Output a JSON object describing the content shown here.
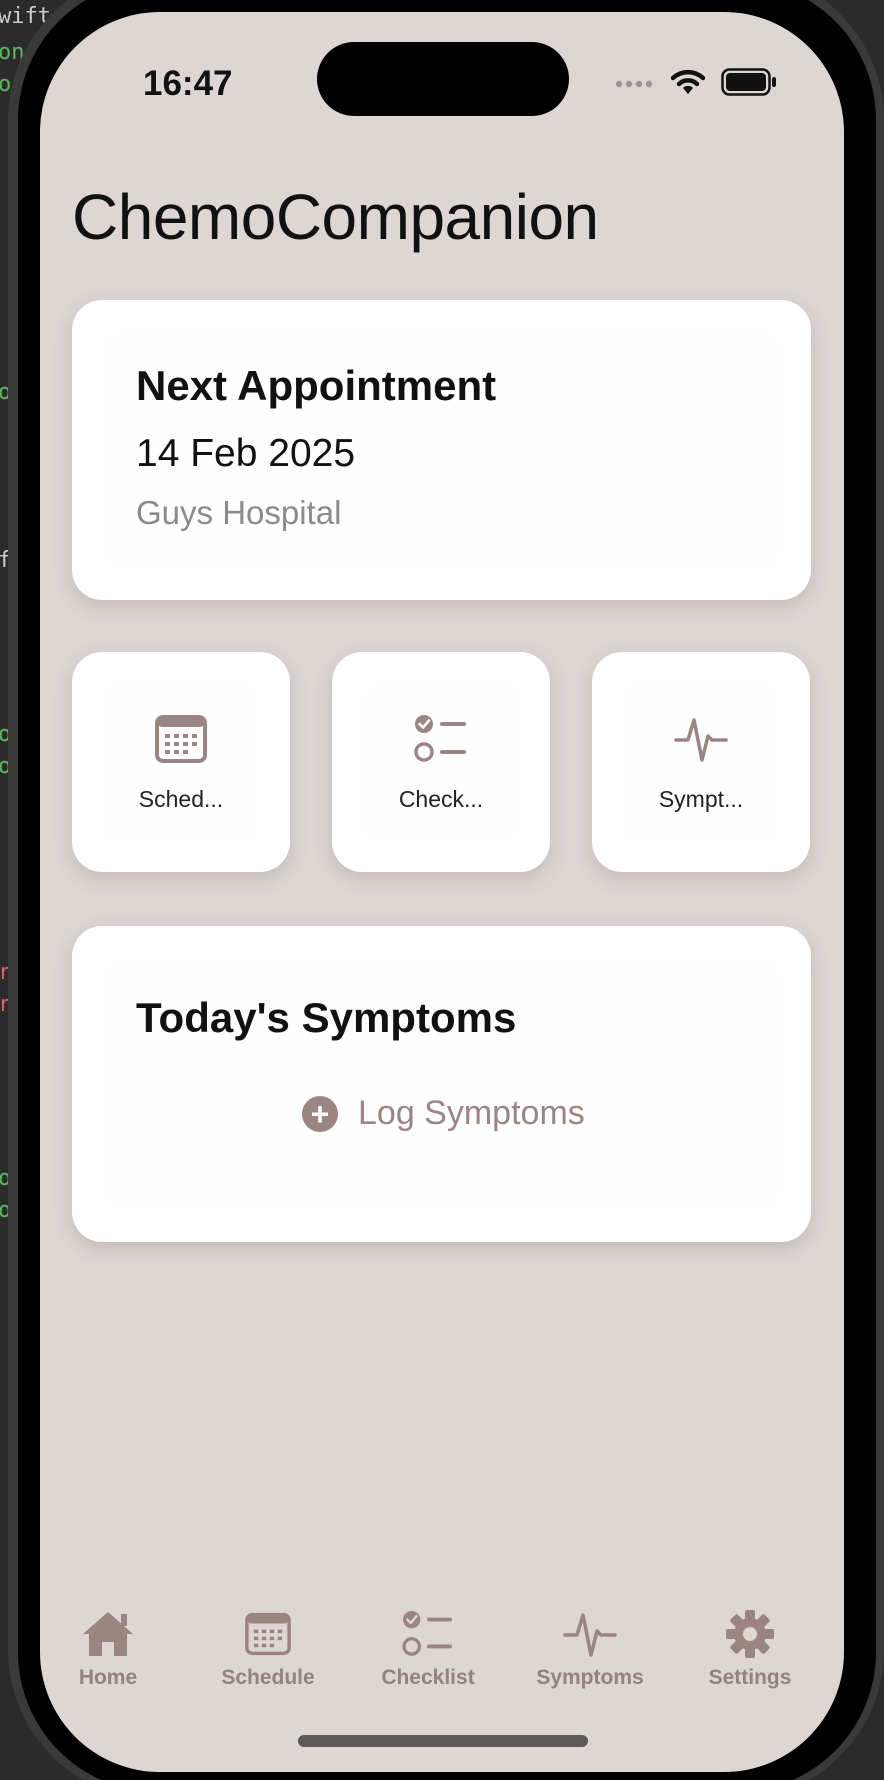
{
  "status_bar": {
    "time": "16:47",
    "icons": [
      "signal-dots-icon",
      "wifi-icon",
      "battery-icon"
    ]
  },
  "app": {
    "title": "ChemoCompanion"
  },
  "next_appointment": {
    "title": "Next Appointment",
    "date": "14 Feb 2025",
    "location": "Guys Hospital"
  },
  "quick_actions": [
    {
      "label": "Sched...",
      "icon": "calendar-icon"
    },
    {
      "label": "Check...",
      "icon": "checklist-icon"
    },
    {
      "label": "Sympt...",
      "icon": "waveform-icon"
    }
  ],
  "todays_symptoms": {
    "title": "Today's Symptoms",
    "log_button": "Log Symptoms"
  },
  "tab_bar": [
    {
      "label": "Home",
      "icon": "house-icon"
    },
    {
      "label": "Schedule",
      "icon": "calendar-icon"
    },
    {
      "label": "Checklist",
      "icon": "checklist-icon"
    },
    {
      "label": "Symptoms",
      "icon": "waveform-icon"
    },
    {
      "label": "Settings",
      "icon": "gear-icon"
    }
  ],
  "colors": {
    "background": "#ddd6d3",
    "accent": "#9a8582",
    "card": "#ffffff"
  },
  "code_fragments": [
    "wift",
    "on",
    "or",
    "o",
    "f",
    "o",
    "o",
    "r",
    "r",
    "o",
    "o"
  ]
}
